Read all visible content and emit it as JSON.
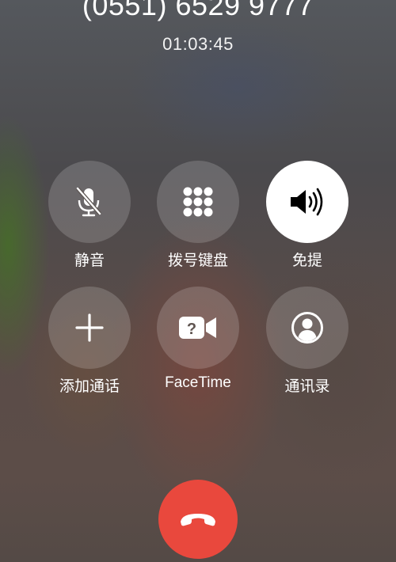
{
  "call": {
    "number": "(0551) 6529 9777",
    "duration": "01:03:45"
  },
  "controls": [
    {
      "label": "静音",
      "icon": "mute-microphone-icon",
      "active": false
    },
    {
      "label": "拨号键盘",
      "icon": "keypad-icon",
      "active": false
    },
    {
      "label": "免提",
      "icon": "speaker-icon",
      "active": true
    },
    {
      "label": "添加通话",
      "icon": "plus-icon",
      "active": false
    },
    {
      "label": "FaceTime",
      "icon": "facetime-video-icon",
      "active": false
    },
    {
      "label": "通讯录",
      "icon": "contacts-icon",
      "active": false
    }
  ],
  "end_call": {
    "icon": "end-call-icon",
    "color": "#e9483d"
  },
  "colors": {
    "button_background": "rgba(255,255,255,0.17)",
    "active_button_background": "#ffffff",
    "end_call": "#e9483d"
  }
}
